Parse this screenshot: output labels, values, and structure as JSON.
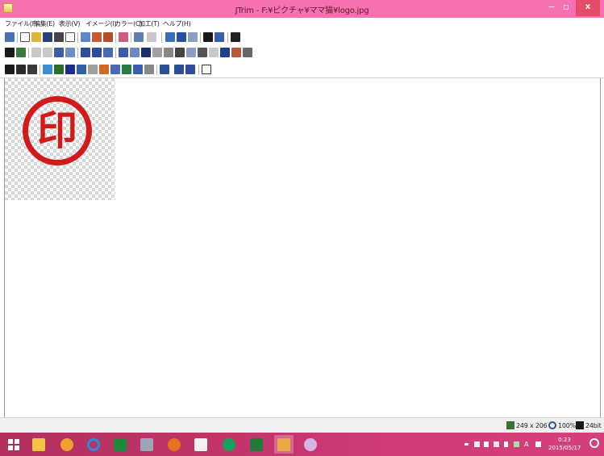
{
  "window": {
    "title": "JTrim - F:¥ピクチャ¥ママ猫¥logo.jpg",
    "minimize_glyph": "−",
    "maximize_glyph": "▫",
    "close_glyph": "x"
  },
  "menu": [
    "ファイル(F)",
    "編集(E)",
    "表示(V)",
    "イメージ(I)",
    "カラー(C)",
    "加工(T)",
    "ヘルプ(H)"
  ],
  "canvas": {
    "stamp_char": "印",
    "stamp_color": "#d11a1a"
  },
  "status": {
    "image_size": "249 x 206",
    "zoom": "100%",
    "bit_depth": "24bit"
  },
  "taskbar": {
    "time": "0:23",
    "date": "2015/05/17",
    "ime_mode": "A",
    "apps": [
      "windows-explorer",
      "feedback",
      "internet-explorer",
      "store",
      "photo-viewer",
      "firefox",
      "bar-chart-app",
      "hangouts",
      "excel",
      "jtrim",
      "paint"
    ]
  },
  "colors": {
    "titlebar": "#f771b0",
    "close_button": "#e54a68",
    "taskbar": "#c2356b"
  }
}
